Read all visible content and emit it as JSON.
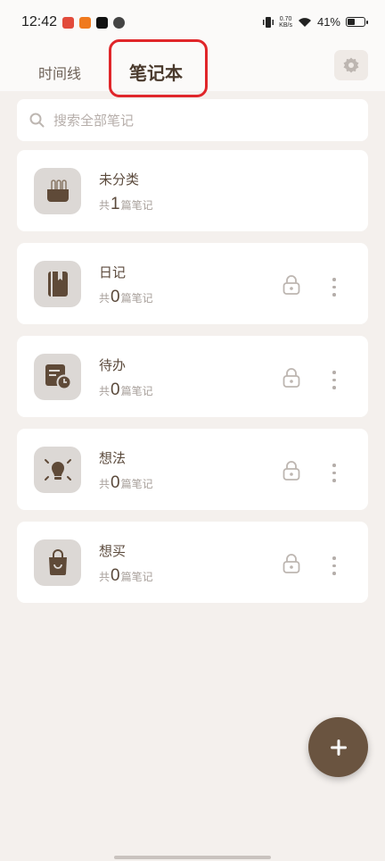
{
  "status_bar": {
    "time": "12:42",
    "speed_value": "0.70",
    "speed_unit": "KB/s",
    "battery": "41%",
    "battery_level": 0.41,
    "notification_icons": [
      "news-icon",
      "orange-app-icon",
      "tiktok-icon",
      "leaf-app-icon"
    ]
  },
  "header": {
    "tab_timeline": "时间线",
    "tab_notebook": "笔记本",
    "settings_icon": "gear-icon",
    "highlight_color": "#e0262a"
  },
  "search": {
    "placeholder": "搜索全部笔记"
  },
  "count_prefix": "共",
  "count_suffix": "篇笔记",
  "notebooks": [
    {
      "title": "未分类",
      "count": "1",
      "icon": "basket-icon",
      "locked": false
    },
    {
      "title": "日记",
      "count": "0",
      "icon": "diary-book-icon",
      "locked": true
    },
    {
      "title": "待办",
      "count": "0",
      "icon": "todo-clock-icon",
      "locked": true
    },
    {
      "title": "想法",
      "count": "0",
      "icon": "lightbulb-icon",
      "locked": true
    },
    {
      "title": "想买",
      "count": "0",
      "icon": "shopping-bag-icon",
      "locked": true
    }
  ],
  "fab": {
    "icon": "plus-icon"
  },
  "colors": {
    "background": "#f4f0ed",
    "brown": "#6a5440",
    "card": "#ffffff"
  }
}
